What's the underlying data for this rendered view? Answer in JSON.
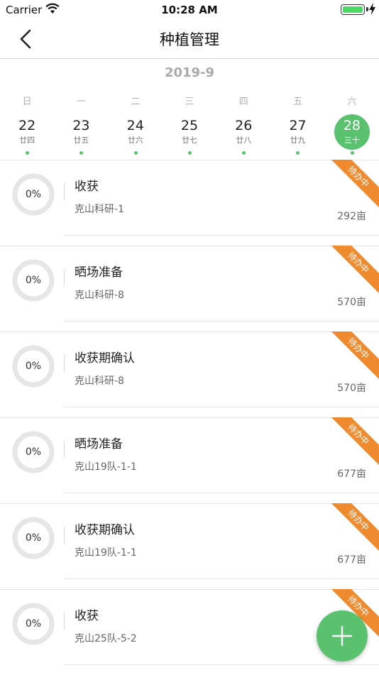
{
  "status_bar": {
    "carrier": "Carrier",
    "time": "10:28 AM",
    "battery_level": 1.0,
    "icons": [
      "wifi-icon",
      "battery-icon",
      "charging-bolt-icon"
    ]
  },
  "nav": {
    "title": "种植管理",
    "back_icon": "chevron-left-icon"
  },
  "calendar": {
    "month": "2019-9",
    "weekdays": [
      "日",
      "一",
      "二",
      "三",
      "四",
      "五",
      "六"
    ],
    "days": [
      {
        "day": "22",
        "lunar": "廿四",
        "has_task": true,
        "selected": false
      },
      {
        "day": "23",
        "lunar": "廿五",
        "has_task": true,
        "selected": false
      },
      {
        "day": "24",
        "lunar": "廿六",
        "has_task": true,
        "selected": false
      },
      {
        "day": "25",
        "lunar": "廿七",
        "has_task": true,
        "selected": false
      },
      {
        "day": "26",
        "lunar": "廿八",
        "has_task": true,
        "selected": false
      },
      {
        "day": "27",
        "lunar": "廿九",
        "has_task": true,
        "selected": false
      },
      {
        "day": "28",
        "lunar": "三十",
        "has_task": true,
        "selected": true
      }
    ]
  },
  "tasks": [
    {
      "progress_label": "0%",
      "progress": 0,
      "title": "收获",
      "field": "克山科研-1",
      "area": "292亩",
      "status": "待办中"
    },
    {
      "progress_label": "0%",
      "progress": 0,
      "title": "晒场准备",
      "field": "克山科研-8",
      "area": "570亩",
      "status": "待办中"
    },
    {
      "progress_label": "0%",
      "progress": 0,
      "title": "收获期确认",
      "field": "克山科研-8",
      "area": "570亩",
      "status": "待办中"
    },
    {
      "progress_label": "0%",
      "progress": 0,
      "title": "晒场准备",
      "field": "克山19队-1-1",
      "area": "677亩",
      "status": "待办中"
    },
    {
      "progress_label": "0%",
      "progress": 0,
      "title": "收获期确认",
      "field": "克山19队-1-1",
      "area": "677亩",
      "status": "待办中"
    },
    {
      "progress_label": "0%",
      "progress": 0,
      "title": "收获",
      "field": "克山25队-5-2",
      "area": "",
      "status": "待办中"
    }
  ],
  "fab": {
    "icon": "plus-icon"
  },
  "colors": {
    "accent": "#5ac26f",
    "status_badge": "#f08a2e",
    "ring": "#e6e6e6"
  }
}
